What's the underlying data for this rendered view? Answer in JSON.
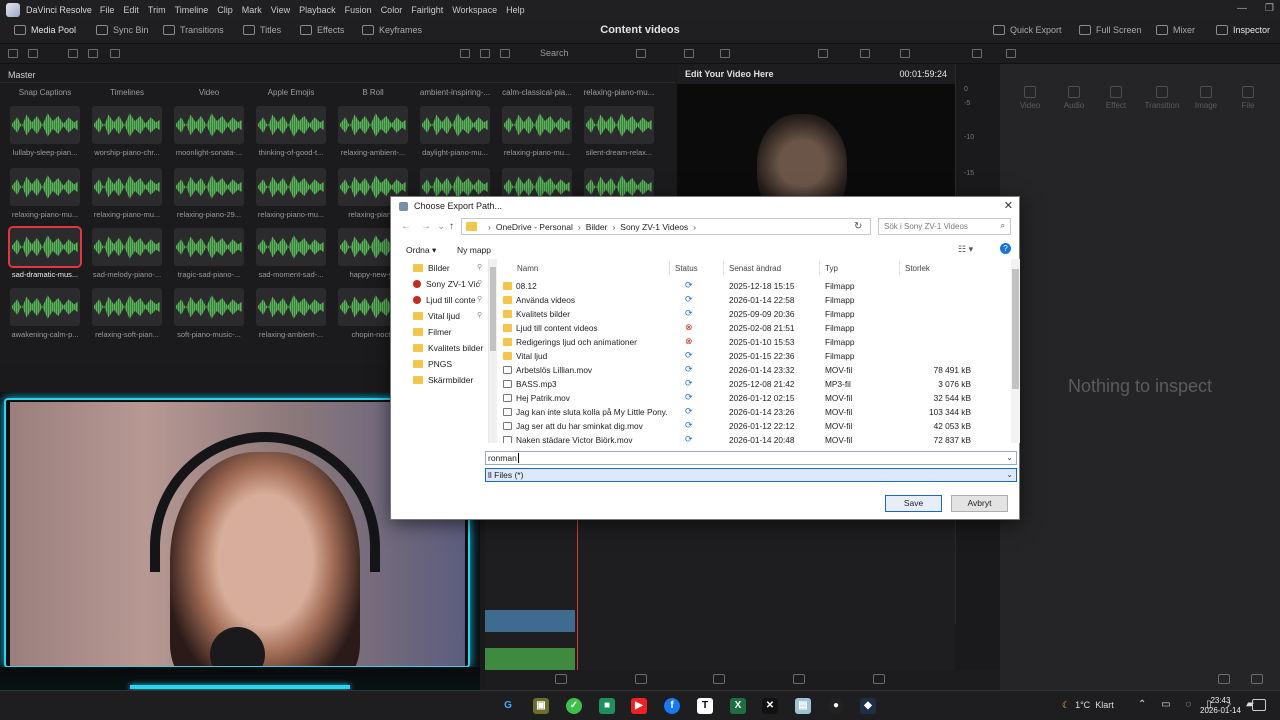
{
  "app": {
    "name": "DaVinci Resolve",
    "menu": [
      "File",
      "Edit",
      "Trim",
      "Timeline",
      "Clip",
      "Mark",
      "View",
      "Playback",
      "Fusion",
      "Color",
      "Fairlight",
      "Workspace",
      "Help"
    ]
  },
  "toolbar": {
    "media_pool": "Media Pool",
    "sync_bin": "Sync Bin",
    "transitions": "Transitions",
    "titles": "Titles",
    "effects": "Effects",
    "keyframes": "Keyframes",
    "project_title": "Content videos",
    "quick_export": "Quick Export",
    "full_screen": "Full Screen",
    "mixer": "Mixer",
    "inspector": "Inspector"
  },
  "search": {
    "placeholder": "Search"
  },
  "media_pool": {
    "master": "Master",
    "bins": [
      "Snap Captions",
      "Timelines",
      "Video",
      "Apple Emojis",
      "B Roll",
      "ambient-inspiring-...",
      "calm-classical-pia...",
      "relaxing-piano-mu..."
    ],
    "clips": [
      [
        "lullaby-sleep-pian...",
        "worship-piano-chr...",
        "moonlight-sonata-...",
        "thinking-of-good-t...",
        "relaxing-ambient-...",
        "daylight-piano-mu...",
        "relaxing-piano-mu...",
        "silent-dream-relax..."
      ],
      [
        "relaxing-piano-mu...",
        "relaxing-piano-mu...",
        "relaxing-piano-29...",
        "relaxing-piano-mu...",
        "relaxing-piano-",
        "",
        "",
        ""
      ],
      [
        "sad-dramatic-mus...",
        "sad-melody-piano-...",
        "tragic-sad-piano-...",
        "sad-moment-sad-...",
        "happy-new-ye",
        "",
        "",
        ""
      ],
      [
        "awakening-calm-p...",
        "relaxing-soft-pian...",
        "soft-piano-music-...",
        "relaxing-ambient-...",
        "chopin-noctu",
        "",
        "",
        ""
      ]
    ],
    "selected_clip": "sad-dramatic-mus..."
  },
  "viewer": {
    "title": "Edit Your Video Here",
    "timecode": "00:01:59:24",
    "meter_labels": [
      "0",
      "-5",
      "-10",
      "-15"
    ]
  },
  "inspector": {
    "tabs": [
      "Video",
      "Audio",
      "Effect",
      "Transition",
      "Image",
      "File"
    ],
    "empty_text": "Nothing to inspect"
  },
  "dialog": {
    "title": "Choose Export Path...",
    "breadcrumb": [
      "OneDrive - Personal",
      "Bilder",
      "Sony ZV-1 Videos"
    ],
    "search_placeholder": "Sök i Sony ZV-1 Videos",
    "organize": "Ordna",
    "new_folder": "Ny mapp",
    "nav_items": [
      {
        "label": "Bilder",
        "icon": "folder"
      },
      {
        "label": "Sony ZV-1 Vic",
        "icon": "error"
      },
      {
        "label": "Ljud till conte",
        "icon": "error"
      },
      {
        "label": "Vital ljud",
        "icon": "folder"
      },
      {
        "label": "Filmer",
        "icon": "folder"
      },
      {
        "label": "Kvalitets bilder",
        "icon": "folder"
      },
      {
        "label": "PNGS",
        "icon": "folder"
      },
      {
        "label": "Skärmbilder",
        "icon": "folder"
      }
    ],
    "columns": [
      "Namn",
      "Status",
      "Senast ändrad",
      "Typ",
      "Storlek"
    ],
    "files": [
      {
        "name": "08.12",
        "status": "sync",
        "modified": "2025-12-18 15:15",
        "type": "Filmapp",
        "size": "",
        "kind": "folder"
      },
      {
        "name": "Använda videos",
        "status": "sync",
        "modified": "2026-01-14 22:58",
        "type": "Filmapp",
        "size": "",
        "kind": "folder"
      },
      {
        "name": "Kvalitets bilder",
        "status": "sync",
        "modified": "2025-09-09 20:36",
        "type": "Filmapp",
        "size": "",
        "kind": "folder"
      },
      {
        "name": "Ljud till content videos",
        "status": "error",
        "modified": "2025-02-08 21:51",
        "type": "Filmapp",
        "size": "",
        "kind": "folder"
      },
      {
        "name": "Redigerings ljud och animationer",
        "status": "error",
        "modified": "2025-01-10 15:53",
        "type": "Filmapp",
        "size": "",
        "kind": "folder"
      },
      {
        "name": "Vital ljud",
        "status": "sync",
        "modified": "2025-01-15 22:36",
        "type": "Filmapp",
        "size": "",
        "kind": "folder"
      },
      {
        "name": "Arbetslös Lillian.mov",
        "status": "sync",
        "modified": "2026-01-14 23:32",
        "type": "MOV-fil",
        "size": "78 491 kB",
        "kind": "file"
      },
      {
        "name": "BASS.mp3",
        "status": "sync",
        "modified": "2025-12-08 21:42",
        "type": "MP3-fil",
        "size": "3 076 kB",
        "kind": "file"
      },
      {
        "name": "Hej Patrik.mov",
        "status": "sync",
        "modified": "2026-01-12 02:15",
        "type": "MOV-fil",
        "size": "32 544 kB",
        "kind": "file"
      },
      {
        "name": "Jag kan inte sluta kolla på My Little Pony....",
        "status": "sync",
        "modified": "2026-01-14 23:26",
        "type": "MOV-fil",
        "size": "103 344 kB",
        "kind": "file"
      },
      {
        "name": "Jag ser att du har sminkat dig.mov",
        "status": "sync",
        "modified": "2026-01-12 22:12",
        "type": "MOV-fil",
        "size": "42 053 kB",
        "kind": "file"
      },
      {
        "name": "Naken städare Victor Björk.mov",
        "status": "sync",
        "modified": "2026-01-14 20:48",
        "type": "MOV-fil",
        "size": "72 837 kB",
        "kind": "file"
      }
    ],
    "filename_value": "ronman",
    "filetype_value": "ll Files (*)",
    "save": "Save",
    "cancel": "Avbryt"
  },
  "taskbar": {
    "temperature": "1°C",
    "weather": "Klart",
    "time": "23:43",
    "date": "2026-01-14"
  },
  "colors": {
    "accent_red": "#e0383e",
    "waveform_green": "#5db35d",
    "webcam_frame": "#2ad6ef",
    "dialog_primary": "#1c66c6"
  }
}
